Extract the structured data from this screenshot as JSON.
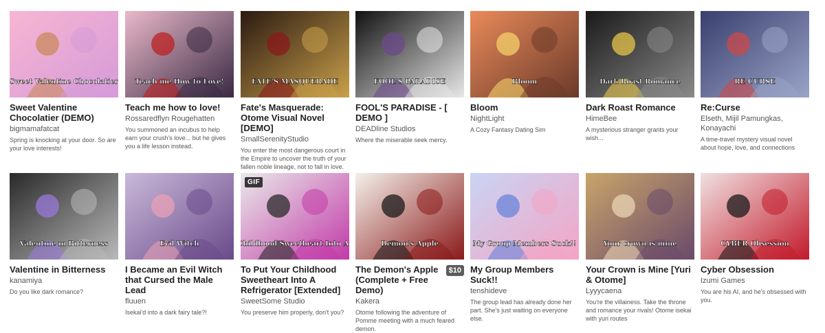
{
  "games": [
    {
      "title": "Sweet Valentine Chocolatier (DEMO)",
      "author": "bigmamafatcat",
      "description": "Spring is knocking at your door. So are your love interests!",
      "thumb_art": "Sweet Valentine Chocolatier",
      "palette": [
        "#f7b6d2",
        "#d59ad9",
        "#c98a5c"
      ]
    },
    {
      "title": "Teach me how to love!",
      "author": "Rossaredflyn Rougehatten",
      "description": "You summoned an incubus to help earn your crush's love... but he gives you a life lesson instead.",
      "thumb_art": "Teach me How to Love!",
      "palette": [
        "#e9b9c9",
        "#3a2a44",
        "#b22"
      ]
    },
    {
      "title": "Fate's Masquerade: Otome Visual Novel [DEMO]",
      "author": "SmallSerenityStudio",
      "description": "You enter the most dangerous court in the Empire to uncover the truth of your fallen noble lineage, not to fall in love.",
      "thumb_art": "FATE'S MASQUERADE",
      "palette": [
        "#2b1a12",
        "#c9a04a",
        "#8a1a1a"
      ]
    },
    {
      "title": "FOOL'S PARADISE - [ DEMO ]",
      "author": "DEADline Studios",
      "description": "Where the miserable seek mercy.",
      "thumb_art": "FOOL'S PARADISE",
      "palette": [
        "#111111",
        "#e8e8e8",
        "#6b4a8a"
      ]
    },
    {
      "title": "Bloom",
      "author": "NightLight",
      "description": "A Cozy Fantasy Dating Sim",
      "thumb_art": "Bloom",
      "palette": [
        "#e98a5a",
        "#6b3a2a",
        "#f4d06a"
      ]
    },
    {
      "title": "Dark Roast Romance",
      "author": "HimeBee",
      "description": "A mysterious stranger grants your wish...",
      "thumb_art": "Dark Roast Romance",
      "palette": [
        "#1a1a1a",
        "#8a8a8a",
        "#e6c44a"
      ]
    },
    {
      "title": "Re:Curse",
      "author": "Elseth, Mijil Pamungkas, Konayachi",
      "description": "A time-travel mystery visual novel about hope, love, and connections",
      "thumb_art": "RE:CURSE",
      "palette": [
        "#3a3f6e",
        "#9aa4c8",
        "#c94a4a"
      ]
    },
    {
      "title": "Valentine in Bitterness",
      "author": "kanamiya",
      "description": "Do you like dark romance?",
      "thumb_art": "Valentine in Bitterness",
      "palette": [
        "#2a2a2a",
        "#b9b9b9",
        "#9a7ad9"
      ]
    },
    {
      "title": "I Became an Evil Witch that Cursed the Male Lead",
      "author": "fluuen",
      "description": "Isekai'd into a dark fairy tale?!",
      "thumb_art": "Evil Witch",
      "palette": [
        "#c9b9d9",
        "#6a4a8a",
        "#e8a0b4"
      ]
    },
    {
      "title": "To Put Your Childhood Sweetheart Into A Refrigerator [Extended]",
      "author": "SweetSome Studio",
      "description": "You preserve him properly, don't you?",
      "thumb_art": "To Put Your Childhood Sweetheart Into A Refrigerator",
      "gif": "GIF",
      "palette": [
        "#e9e9e9",
        "#c23aa8",
        "#2a2a2a"
      ]
    },
    {
      "title": "The Demon's Apple (Complete + Free Demo)",
      "author": "Kakera",
      "description": "Otome following the adventure of Pomme meeting with a much feared demon.",
      "thumb_art": "Demon's Apple",
      "price": "$10",
      "palette": [
        "#f4f0ea",
        "#8a1a1a",
        "#1a1a1a"
      ]
    },
    {
      "title": "My Group Members Suck!!",
      "author": "tenshideve",
      "description": "The group lead has already done her part. She's just waiting on everyone else.",
      "thumb_art": "My Group Members Suck!!",
      "palette": [
        "#c9d4f4",
        "#f4a4c4",
        "#6a84d9"
      ]
    },
    {
      "title": "Your Crown is Mine [Yuri & Otome]",
      "author": "Lyyycaena",
      "description": "You're the villainess. Take the throne and romance your rivals! Otome isekai with yuri routes",
      "thumb_art": "Your crown is mine",
      "palette": [
        "#c9a46a",
        "#6a4a6a",
        "#e9d4b4"
      ]
    },
    {
      "title": "Cyber Obsession",
      "author": "Izumi Games",
      "description": "You are his AI, and he's obsessed with you.",
      "thumb_art": "CYBER Obsession",
      "palette": [
        "#f0e0e0",
        "#c21a2a",
        "#1a1a1a"
      ]
    }
  ]
}
